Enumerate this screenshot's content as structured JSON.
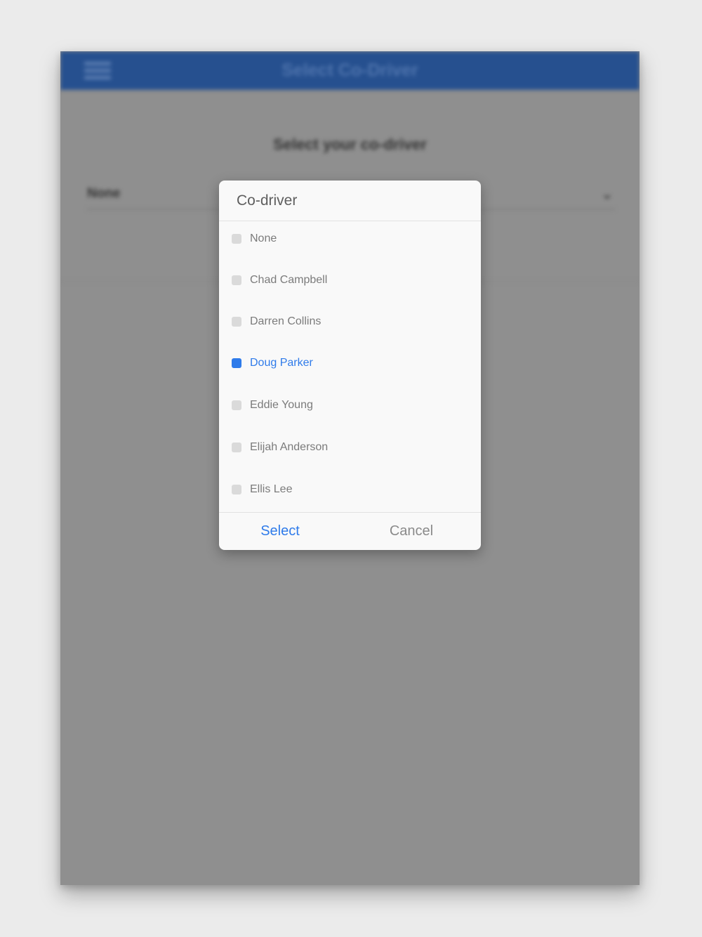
{
  "app": {
    "title": "Select Co-Driver",
    "menu_icon": "hamburger-menu-icon"
  },
  "page": {
    "heading": "Select your co-driver",
    "dropdown_value": "None",
    "dropdown_icon": "chevron-down-icon"
  },
  "dialog": {
    "title": "Co-driver",
    "options": [
      {
        "label": "None",
        "selected": false
      },
      {
        "label": "Chad Campbell",
        "selected": false
      },
      {
        "label": "Darren Collins",
        "selected": false
      },
      {
        "label": "Doug Parker",
        "selected": true
      },
      {
        "label": "Eddie Young",
        "selected": false
      },
      {
        "label": "Elijah Anderson",
        "selected": false
      },
      {
        "label": "Ellis Lee",
        "selected": false
      }
    ],
    "select_label": "Select",
    "cancel_label": "Cancel"
  },
  "colors": {
    "header": "#26508f",
    "accent": "#2f7bea",
    "overlay": "#8f8f8f"
  }
}
